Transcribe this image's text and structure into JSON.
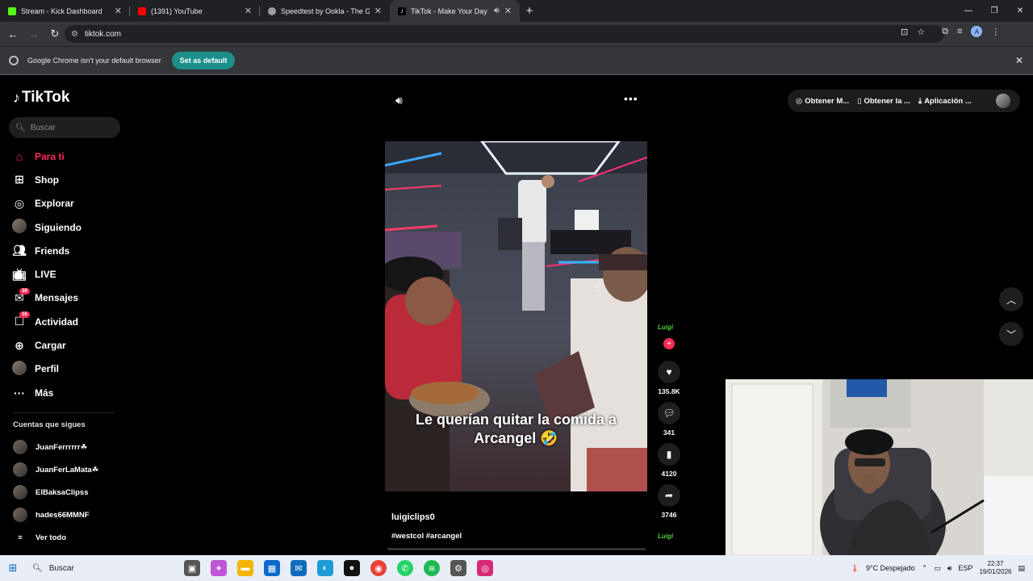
{
  "browser": {
    "tabs": [
      {
        "title": "Stream - Kick Dashboard",
        "color": "#53fc18"
      },
      {
        "title": "(1391) YouTube",
        "color": "#ff0000"
      },
      {
        "title": "Speedtest by Ookla - The Glob",
        "color": "#9e9e9e"
      },
      {
        "title": "TikTok - Make Your Day",
        "color": "#ffffff"
      }
    ],
    "url": "tiktok.com",
    "infobar_text": "Google Chrome isn't your default browser",
    "set_default_label": "Set as default",
    "profile_initial": "A"
  },
  "tiktok": {
    "logo": "TikTok",
    "search_placeholder": "Buscar",
    "nav": [
      {
        "label": "Para ti"
      },
      {
        "label": "Shop"
      },
      {
        "label": "Explorar"
      },
      {
        "label": "Siguiendo"
      },
      {
        "label": "Friends"
      },
      {
        "label": "LIVE"
      },
      {
        "label": "Mensajes",
        "badge": "38"
      },
      {
        "label": "Actividad",
        "badge": "16"
      },
      {
        "label": "Cargar"
      },
      {
        "label": "Perfil"
      },
      {
        "label": "Más"
      }
    ],
    "following_header": "Cuentas que sigues",
    "following": [
      {
        "name": "JuanFerrrrrr☘"
      },
      {
        "name": "JuanFerLaMata☘"
      },
      {
        "name": "ElBaksaClipss"
      },
      {
        "name": "hades66MMNF"
      }
    ],
    "see_all": "Ver todo",
    "top_actions": [
      "Obtener M...",
      "Obtener la ...",
      "Aplicación ..."
    ],
    "video": {
      "caption_line1": "Le querían quitar la comida a",
      "caption_line2": "Arcangel 🤣",
      "username": "luigiclips0",
      "tags": "#westcol #arcangel",
      "likes": "135.8K",
      "comments": "341",
      "saves": "4120",
      "shares": "3746",
      "creator_logo": "Luigi"
    }
  },
  "taskbar": {
    "search": "Buscar",
    "weather": "9°C  Despejado",
    "lang": "ESP",
    "time": "22:37",
    "date": "19/01/2026"
  }
}
